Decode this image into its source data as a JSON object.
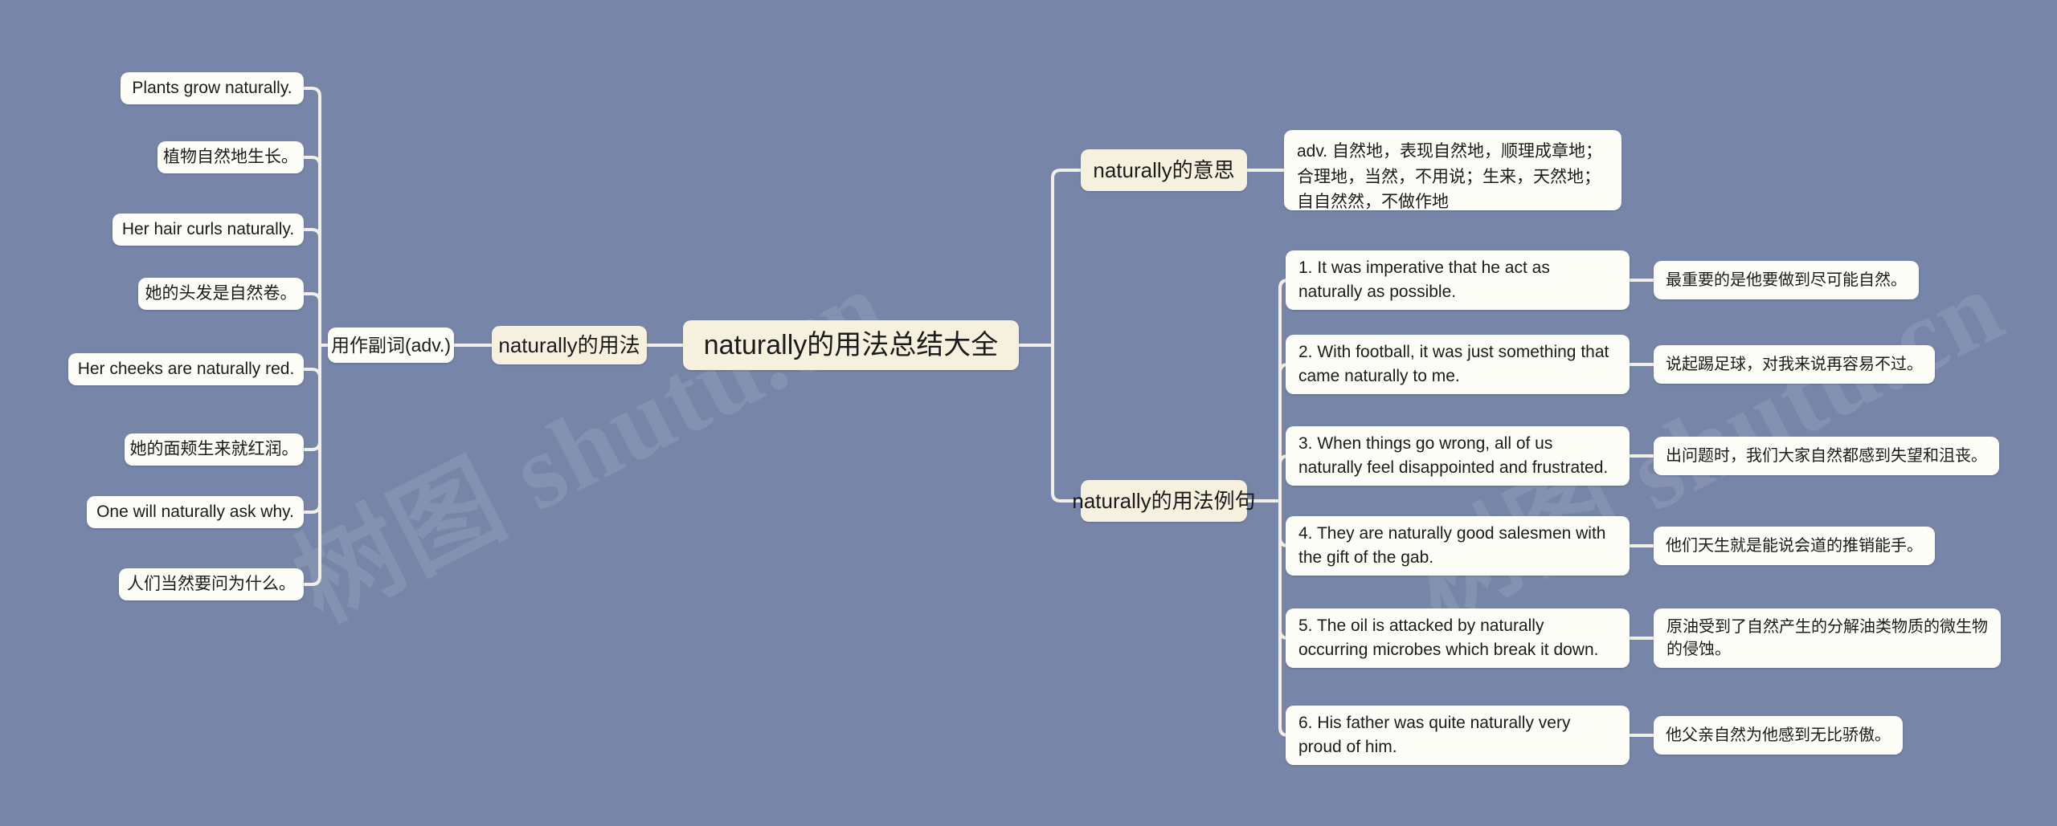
{
  "meta": {
    "background_color": "#7785a8",
    "node_white": "#fdfdf7",
    "node_cream": "#f6f1df",
    "connector_color": "#f2f0e6",
    "watermark": "树图 shutu.cn"
  },
  "root": {
    "label": "naturally的用法总结大全"
  },
  "branches": {
    "usage": {
      "label": "naturally的用法",
      "child": {
        "label": "用作副词(adv.)",
        "examples": [
          "Plants grow naturally.",
          "植物自然地生长。",
          "Her hair curls naturally.",
          "她的头发是自然卷。",
          "Her cheeks are naturally red.",
          "她的面颊生来就红润。",
          "One will naturally ask why.",
          "人们当然要问为什么。"
        ]
      }
    },
    "meaning": {
      "label": "naturally的意思",
      "definition": "adv. 自然地，表现自然地，顺理成章地；合理地，当然，不用说；生来，天然地；自自然然，不做作地"
    },
    "sentences": {
      "label": "naturally的用法例句",
      "items": [
        {
          "en": "1. It was imperative that he act as naturally as possible.",
          "zh": "最重要的是他要做到尽可能自然。"
        },
        {
          "en": "2. With football, it was just something that came naturally to me.",
          "zh": "说起踢足球，对我来说再容易不过。"
        },
        {
          "en": "3. When things go wrong, all of us naturally feel disappointed and frustrated.",
          "zh": "出问题时，我们大家自然都感到失望和沮丧。"
        },
        {
          "en": "4. They are naturally good salesmen with the gift of the gab.",
          "zh": "他们天生就是能说会道的推销能手。"
        },
        {
          "en": "5. The oil is attacked by naturally occurring microbes which break it down.",
          "zh": "原油受到了自然产生的分解油类物质的微生物的侵蚀。"
        },
        {
          "en": "6. His father was quite naturally very proud of him.",
          "zh": "他父亲自然为他感到无比骄傲。"
        }
      ]
    }
  }
}
